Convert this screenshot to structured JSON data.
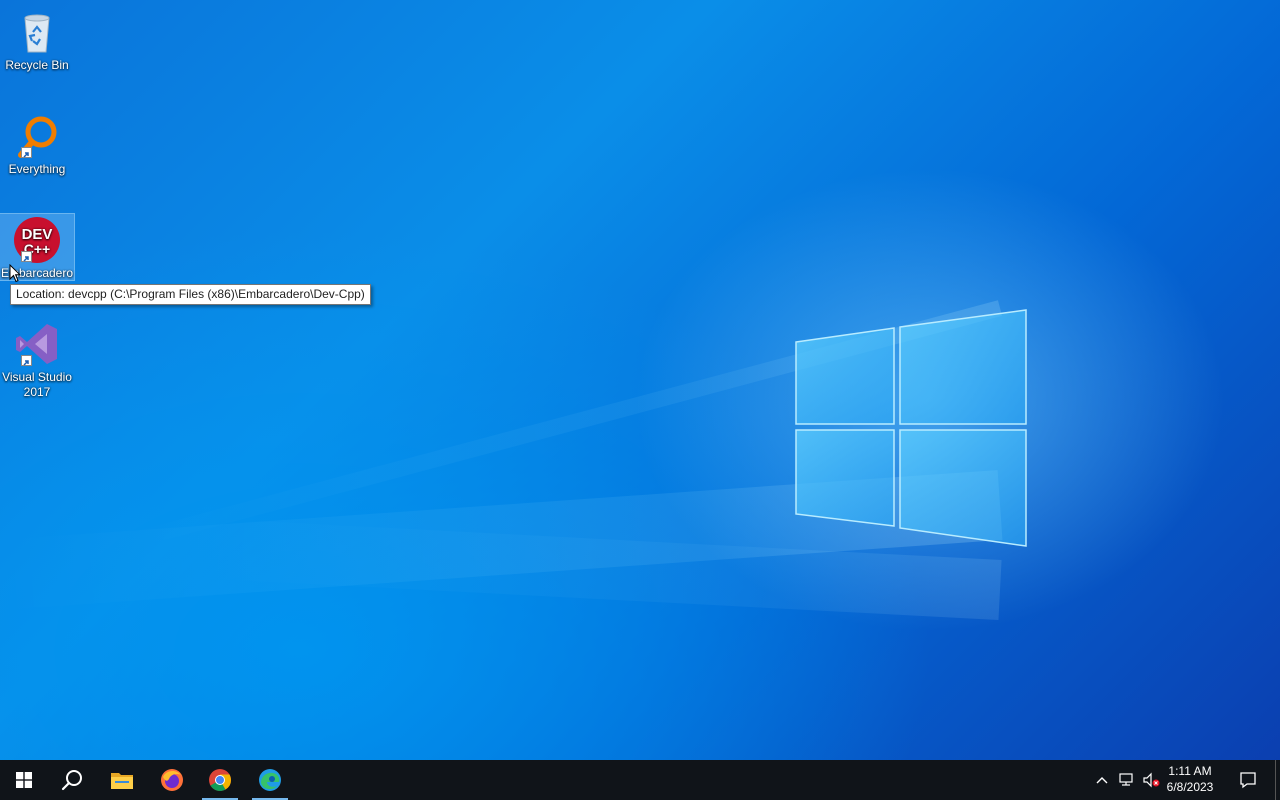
{
  "desktop": {
    "icons": [
      {
        "label": "Recycle Bin",
        "icon": "recycle-bin-icon"
      },
      {
        "label": "Everything",
        "icon": "everything-search-icon"
      },
      {
        "label": "Embarcadero",
        "icon": "dev-cpp-icon",
        "selected": true,
        "logo_text_top": "DEV",
        "logo_text_bottom": "C++"
      },
      {
        "label": "Visual Studio 2017",
        "icon": "visual-studio-icon"
      }
    ],
    "tooltip": "Location: devcpp (C:\\Program Files (x86)\\Embarcadero\\Dev-Cpp)"
  },
  "taskbar": {
    "items": [
      {
        "icon": "windows-start-icon",
        "active": false
      },
      {
        "icon": "search-icon",
        "active": false
      },
      {
        "icon": "file-explorer-icon",
        "active": false
      },
      {
        "icon": "firefox-icon",
        "active": false
      },
      {
        "icon": "chrome-icon",
        "active": true
      },
      {
        "icon": "edge-icon",
        "active": true
      }
    ],
    "tray": {
      "icons": [
        "show-hidden-icons-chevron",
        "network-disconnected-icon",
        "volume-muted-icon",
        "notification-center-icon"
      ],
      "time": "1:11 AM",
      "date": "6/8/2023"
    }
  },
  "colors": {
    "taskbar": "#101419",
    "accent_underline": "#76b9ed",
    "desktop_blue": "#0a8ee8"
  }
}
